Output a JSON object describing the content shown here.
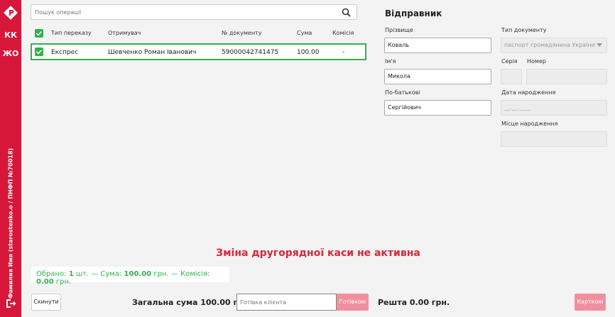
{
  "sidebar": {
    "btn_kk": "КК",
    "btn_zho": "ЖО",
    "user_text": "Фамилия Имя (starostenko.o / ПНФП №70018)"
  },
  "search": {
    "placeholder": "Пошук операції"
  },
  "table": {
    "headers": [
      "Тип переказу",
      "Отримувач",
      "№ документу",
      "Сума",
      "Комісія"
    ],
    "rows": [
      {
        "type": "Експрес",
        "recipient": "Шевченко Роман Іванович",
        "doc": "59000042741475",
        "sum": "100.00",
        "commission": "-"
      }
    ]
  },
  "sender": {
    "title": "Відправник",
    "surname_label": "Прізвище",
    "surname": "Коваль",
    "name_label": "Ім'я",
    "name": "Микола",
    "patronymic_label": "По-батькові",
    "patronymic": "Сергійович",
    "doc_type_label": "Тип документу",
    "doc_type": "паспорт громадянина України",
    "series_label": "Серія",
    "number_label": "Номер",
    "birthdate_label": "Дата народження",
    "birthdate_placeholder": "__.__.____",
    "birthplace_label": "Місце народження"
  },
  "warning": "Зміна другорядної каси не активна",
  "summary": {
    "selected_prefix": "Обрано:",
    "selected_count": "1",
    "selected_unit": "шт. — Сума:",
    "sum": "100.00",
    "sum_unit": "грн. — Комісія:",
    "commission": "0.00",
    "commission_unit": "грн."
  },
  "footer": {
    "reset": "Скинути",
    "total": "Загальна сума 100.00 грн.",
    "cash_placeholder": "Готівка клієнта",
    "cash_button": "Готівкою",
    "change": "Решта 0.00 грн.",
    "card_button": "Карткою"
  },
  "colors": {
    "brand": "#d6173a",
    "accent_green": "#2fb24c",
    "warning": "#d6283a",
    "button_disabled": "#f1909d"
  }
}
